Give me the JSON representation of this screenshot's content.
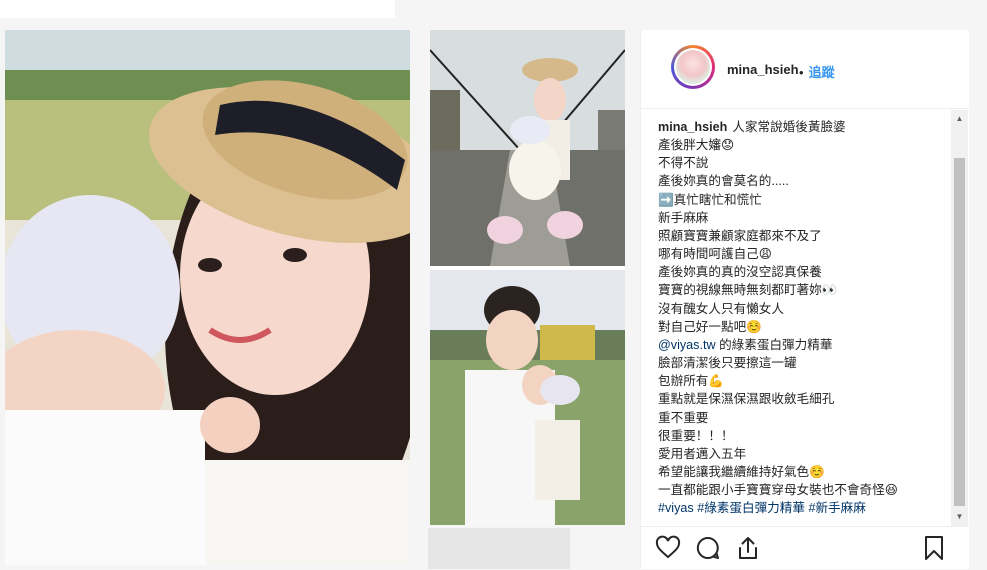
{
  "post": {
    "username": "mina_hsieh",
    "separator": "•",
    "follow_label": "追蹤"
  },
  "caption": {
    "user": "mina_hsieh",
    "lines": [
      "人家常說婚後黃臉婆",
      "產後胖大嬸😟",
      "不得不說",
      "產後妳真的會莫名的.....",
      "➡️真忙瞎忙和慌忙",
      "新手麻麻",
      "照顧寶寶兼顧家庭都來不及了",
      "哪有時間呵護自己😩",
      "產後妳真的真的沒空認真保養",
      "寶寶的視線無時無刻都盯著妳👀",
      "沒有醜女人只有懶女人",
      "對自己好一點吧☺️",
      "@viyas.tw 的綠素蛋白彈力精華",
      "臉部清潔後只要擦這一罐",
      "包辦所有💪",
      "重點就是保濕保濕跟收斂毛細孔",
      "重不重要",
      "很重要！！！",
      "愛用者邁入五年",
      "希望能讓我繼續維持好氣色☺️",
      "一直都能跟小手寶寶穿母女裝也不會奇怪😆",
      "#viyas #綠素蛋白彈力精華 #新手麻麻"
    ],
    "mention": "@viyas.tw",
    "mention_rest": " 的綠素蛋白彈力精華",
    "hashtags": "#viyas #綠素蛋白彈力精華 #新手麻麻"
  },
  "icons": {
    "like": "heart-icon",
    "comment": "comment-icon",
    "share": "share-icon",
    "save": "bookmark-icon"
  },
  "colors": {
    "link": "#3897f0",
    "mention": "#003569"
  }
}
